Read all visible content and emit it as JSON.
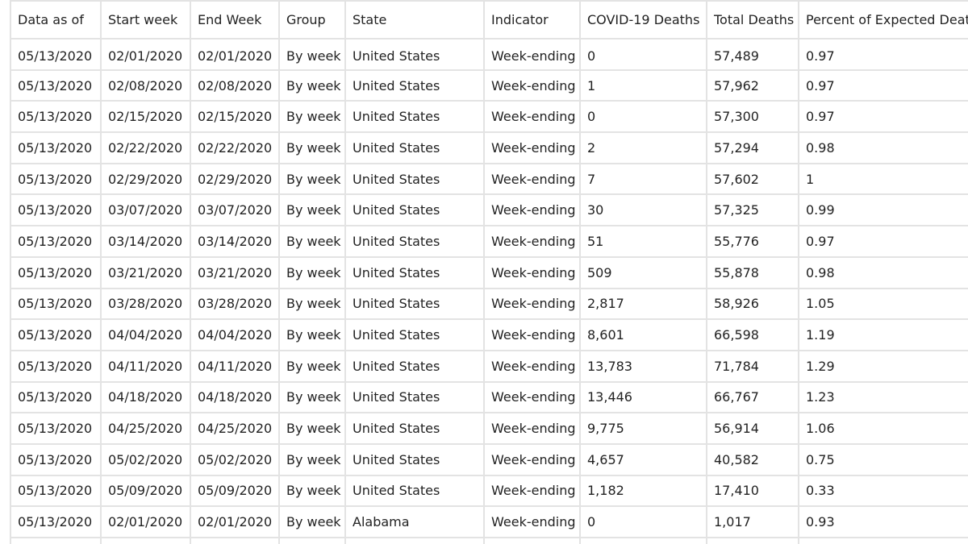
{
  "table": {
    "columns": [
      "Data as of",
      "Start week",
      "End Week",
      "Group",
      "State",
      "Indicator",
      "COVID-19 Deaths",
      "Total Deaths",
      "Percent of Expected Deaths"
    ],
    "rows": [
      [
        "05/13/2020",
        "02/01/2020",
        "02/01/2020",
        "By week",
        "United States",
        "Week-ending",
        "0",
        "57,489",
        "0.97"
      ],
      [
        "05/13/2020",
        "02/08/2020",
        "02/08/2020",
        "By week",
        "United States",
        "Week-ending",
        "1",
        "57,962",
        "0.97"
      ],
      [
        "05/13/2020",
        "02/15/2020",
        "02/15/2020",
        "By week",
        "United States",
        "Week-ending",
        "0",
        "57,300",
        "0.97"
      ],
      [
        "05/13/2020",
        "02/22/2020",
        "02/22/2020",
        "By week",
        "United States",
        "Week-ending",
        "2",
        "57,294",
        "0.98"
      ],
      [
        "05/13/2020",
        "02/29/2020",
        "02/29/2020",
        "By week",
        "United States",
        "Week-ending",
        "7",
        "57,602",
        "1"
      ],
      [
        "05/13/2020",
        "03/07/2020",
        "03/07/2020",
        "By week",
        "United States",
        "Week-ending",
        "30",
        "57,325",
        "0.99"
      ],
      [
        "05/13/2020",
        "03/14/2020",
        "03/14/2020",
        "By week",
        "United States",
        "Week-ending",
        "51",
        "55,776",
        "0.97"
      ],
      [
        "05/13/2020",
        "03/21/2020",
        "03/21/2020",
        "By week",
        "United States",
        "Week-ending",
        "509",
        "55,878",
        "0.98"
      ],
      [
        "05/13/2020",
        "03/28/2020",
        "03/28/2020",
        "By week",
        "United States",
        "Week-ending",
        "2,817",
        "58,926",
        "1.05"
      ],
      [
        "05/13/2020",
        "04/04/2020",
        "04/04/2020",
        "By week",
        "United States",
        "Week-ending",
        "8,601",
        "66,598",
        "1.19"
      ],
      [
        "05/13/2020",
        "04/11/2020",
        "04/11/2020",
        "By week",
        "United States",
        "Week-ending",
        "13,783",
        "71,784",
        "1.29"
      ],
      [
        "05/13/2020",
        "04/18/2020",
        "04/18/2020",
        "By week",
        "United States",
        "Week-ending",
        "13,446",
        "66,767",
        "1.23"
      ],
      [
        "05/13/2020",
        "04/25/2020",
        "04/25/2020",
        "By week",
        "United States",
        "Week-ending",
        "9,775",
        "56,914",
        "1.06"
      ],
      [
        "05/13/2020",
        "05/02/2020",
        "05/02/2020",
        "By week",
        "United States",
        "Week-ending",
        "4,657",
        "40,582",
        "0.75"
      ],
      [
        "05/13/2020",
        "05/09/2020",
        "05/09/2020",
        "By week",
        "United States",
        "Week-ending",
        "1,182",
        "17,410",
        "0.33"
      ],
      [
        "05/13/2020",
        "02/01/2020",
        "02/01/2020",
        "By week",
        "Alabama",
        "Week-ending",
        "0",
        "1,017",
        "0.93"
      ],
      [
        "",
        "",
        "",
        "",
        "",
        "",
        "",
        "",
        ""
      ]
    ]
  }
}
